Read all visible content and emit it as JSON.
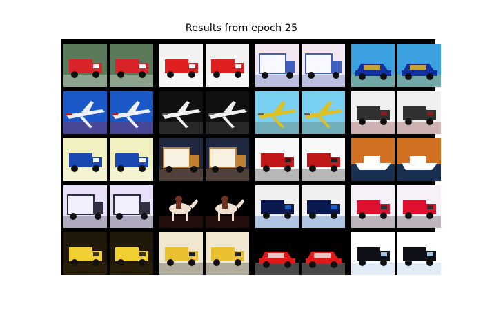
{
  "figure": {
    "title": "Results from epoch 25"
  },
  "grid": {
    "rows": 5,
    "pairs_per_row": 4,
    "tiles": [
      [
        {
          "subject": "red fire truck",
          "bg": "#5a7a5a",
          "body": "#d8232a",
          "accent": "#ffffff",
          "shape": "truck"
        },
        {
          "subject": "red fire truck (reconstruction)",
          "bg": "#5a7a5a",
          "body": "#d8232a",
          "accent": "#ffffff",
          "shape": "truck"
        },
        {
          "subject": "red and white fire truck",
          "bg": "#f2f2f2",
          "body": "#e02020",
          "accent": "#ffffff",
          "shape": "truck"
        },
        {
          "subject": "red and white fire truck (reconstruction)",
          "bg": "#f2f2f2",
          "body": "#e02020",
          "accent": "#ffffff",
          "shape": "truck"
        },
        {
          "subject": "white box truck",
          "bg": "#f4e8f0",
          "body": "#f8f8ff",
          "accent": "#4060c0",
          "shape": "box"
        },
        {
          "subject": "white box truck (reconstruction)",
          "bg": "#f4e8f0",
          "body": "#f8f8ff",
          "accent": "#4060c0",
          "shape": "box"
        },
        {
          "subject": "blue car",
          "bg": "#3aa0e0",
          "body": "#1030a0",
          "accent": "#f0c020",
          "shape": "car"
        },
        {
          "subject": "blue car (reconstruction)",
          "bg": "#3aa0e0",
          "body": "#1030a0",
          "accent": "#f0c020",
          "shape": "car"
        }
      ],
      [
        {
          "subject": "airplane over blue sky",
          "bg": "#1a58c8",
          "body": "#f0f0f8",
          "accent": "#b02020",
          "shape": "plane"
        },
        {
          "subject": "airplane over blue sky (reconstruction)",
          "bg": "#1a58c8",
          "body": "#f0f0f8",
          "accent": "#b02020",
          "shape": "plane"
        },
        {
          "subject": "airliner landing",
          "bg": "#101010",
          "body": "#f0f0f0",
          "accent": "#606060",
          "shape": "plane"
        },
        {
          "subject": "airliner landing (reconstruction)",
          "bg": "#101010",
          "body": "#f0f0f0",
          "accent": "#606060",
          "shape": "plane"
        },
        {
          "subject": "yellow small plane",
          "bg": "#7ad0f0",
          "body": "#e0c020",
          "accent": "#606040",
          "shape": "plane"
        },
        {
          "subject": "yellow small plane (reconstruction)",
          "bg": "#7ad0f0",
          "body": "#e0c020",
          "accent": "#606040",
          "shape": "plane"
        },
        {
          "subject": "dark military vehicle",
          "bg": "#f0f0f0",
          "body": "#303030",
          "accent": "#802020",
          "shape": "truck"
        },
        {
          "subject": "dark military vehicle (reconstruction)",
          "bg": "#f0f0f0",
          "body": "#303030",
          "accent": "#802020",
          "shape": "truck"
        }
      ],
      [
        {
          "subject": "blue truck",
          "bg": "#f0f0c0",
          "body": "#1848b0",
          "accent": "#ffffff",
          "shape": "truck"
        },
        {
          "subject": "blue truck (reconstruction)",
          "bg": "#f0f0c0",
          "body": "#1848b0",
          "accent": "#ffffff",
          "shape": "truck"
        },
        {
          "subject": "white delivery truck",
          "bg": "#202840",
          "body": "#f8f0e0",
          "accent": "#c08030",
          "shape": "box"
        },
        {
          "subject": "white delivery truck (reconstruction)",
          "bg": "#202840",
          "body": "#f8f0e0",
          "accent": "#c08030",
          "shape": "box"
        },
        {
          "subject": "red truck on road",
          "bg": "#f8f8f8",
          "body": "#c01818",
          "accent": "#202020",
          "shape": "truck"
        },
        {
          "subject": "red truck on road (reconstruction)",
          "bg": "#f8f8f8",
          "body": "#c01818",
          "accent": "#202020",
          "shape": "truck"
        },
        {
          "subject": "white boat, autumn trees",
          "bg": "#d07020",
          "body": "#ffffff",
          "accent": "#1a3050",
          "shape": "boat"
        },
        {
          "subject": "white boat, autumn trees (reconstruction)",
          "bg": "#d07020",
          "body": "#ffffff",
          "accent": "#1a3050",
          "shape": "boat"
        }
      ],
      [
        {
          "subject": "white semi truck",
          "bg": "#e8e0f8",
          "body": "#f0f0ff",
          "accent": "#303040",
          "shape": "box"
        },
        {
          "subject": "white semi truck (reconstruction)",
          "bg": "#e8e0f8",
          "body": "#f0f0ff",
          "accent": "#303040",
          "shape": "box"
        },
        {
          "subject": "horse and rider",
          "bg": "#000000",
          "body": "#f0e0d0",
          "accent": "#703020",
          "shape": "animal"
        },
        {
          "subject": "horse and rider (reconstruction)",
          "bg": "#000000",
          "body": "#f0e0d0",
          "accent": "#703020",
          "shape": "animal"
        },
        {
          "subject": "dark blue truck",
          "bg": "#f0f0f0",
          "body": "#0a1a50",
          "accent": "#1a60c0",
          "shape": "truck"
        },
        {
          "subject": "dark blue truck (reconstruction)",
          "bg": "#f0f0f0",
          "body": "#0a1a50",
          "accent": "#1a60c0",
          "shape": "truck"
        },
        {
          "subject": "red semi truck",
          "bg": "#f8f0f8",
          "body": "#e01030",
          "accent": "#303030",
          "shape": "truck"
        },
        {
          "subject": "red semi truck (reconstruction)",
          "bg": "#f8f0f8",
          "body": "#e01030",
          "accent": "#303030",
          "shape": "truck"
        }
      ],
      [
        {
          "subject": "yellow dump truck",
          "bg": "#201808",
          "body": "#f0d030",
          "accent": "#403010",
          "shape": "truck"
        },
        {
          "subject": "yellow dump truck (reconstruction)",
          "bg": "#201808",
          "body": "#f0d030",
          "accent": "#403010",
          "shape": "truck"
        },
        {
          "subject": "yellow construction vehicle",
          "bg": "#f0e8d0",
          "body": "#e8c030",
          "accent": "#202020",
          "shape": "truck"
        },
        {
          "subject": "yellow construction vehicle (reconstruction)",
          "bg": "#f0e8d0",
          "body": "#e8c030",
          "accent": "#202020",
          "shape": "truck"
        },
        {
          "subject": "red vehicle front",
          "bg": "#000000",
          "body": "#e01818",
          "accent": "#f0f0f0",
          "shape": "car"
        },
        {
          "subject": "red vehicle front (reconstruction)",
          "bg": "#000000",
          "body": "#e01818",
          "accent": "#f0f0f0",
          "shape": "car"
        },
        {
          "subject": "small truck on white",
          "bg": "#ffffff",
          "body": "#101018",
          "accent": "#a0c0e0",
          "shape": "truck"
        },
        {
          "subject": "small truck on white (reconstruction)",
          "bg": "#ffffff",
          "body": "#101018",
          "accent": "#a0c0e0",
          "shape": "truck"
        }
      ]
    ]
  }
}
